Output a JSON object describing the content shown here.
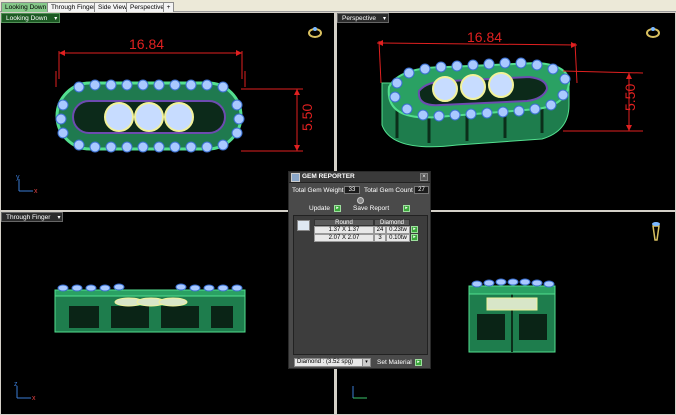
{
  "tabs": [
    {
      "label": "Looking Down",
      "active": true
    },
    {
      "label": "Through Finger",
      "active": false
    },
    {
      "label": "Side View",
      "active": false
    },
    {
      "label": "Perspective",
      "active": false
    }
  ],
  "tab_add": "+",
  "viewports": {
    "top_left": {
      "label": "Looking Down",
      "dim_width": "16.84",
      "dim_height": "5.50"
    },
    "top_right": {
      "label": "Perspective",
      "dim_width": "16.84",
      "dim_height": "5.50"
    },
    "bottom_left": {
      "label": "Through Finger"
    },
    "bottom_right": {
      "label": ""
    }
  },
  "axis_labels": {
    "y": "y",
    "x": "x",
    "z": "z"
  },
  "dropdown_glyph": "▾",
  "gem_reporter": {
    "title": "GEM REPORTER",
    "close": "×",
    "total_gem_weight_label": "Total Gem Weight",
    "total_gem_weight": "33",
    "total_gem_count_label": "Total Gem Count",
    "total_gem_count": "27",
    "update_label": "Update",
    "save_report_label": "Save Report",
    "table": {
      "headers": [
        "Round",
        "Diamond"
      ],
      "rows": [
        {
          "size": "1.37 X 1.37",
          "count": "24",
          "weight": "0.23tw"
        },
        {
          "size": "2.07 X 2.07",
          "count": "3",
          "weight": "0.10tw"
        }
      ]
    },
    "material": "Diamond : (3.52 spg)",
    "set_material_label": "Set Material"
  },
  "colors": {
    "active_tab": "#86c98a",
    "dimension": "#e02020",
    "metal": "#3cc47a",
    "gem": "#a9c9ff"
  }
}
